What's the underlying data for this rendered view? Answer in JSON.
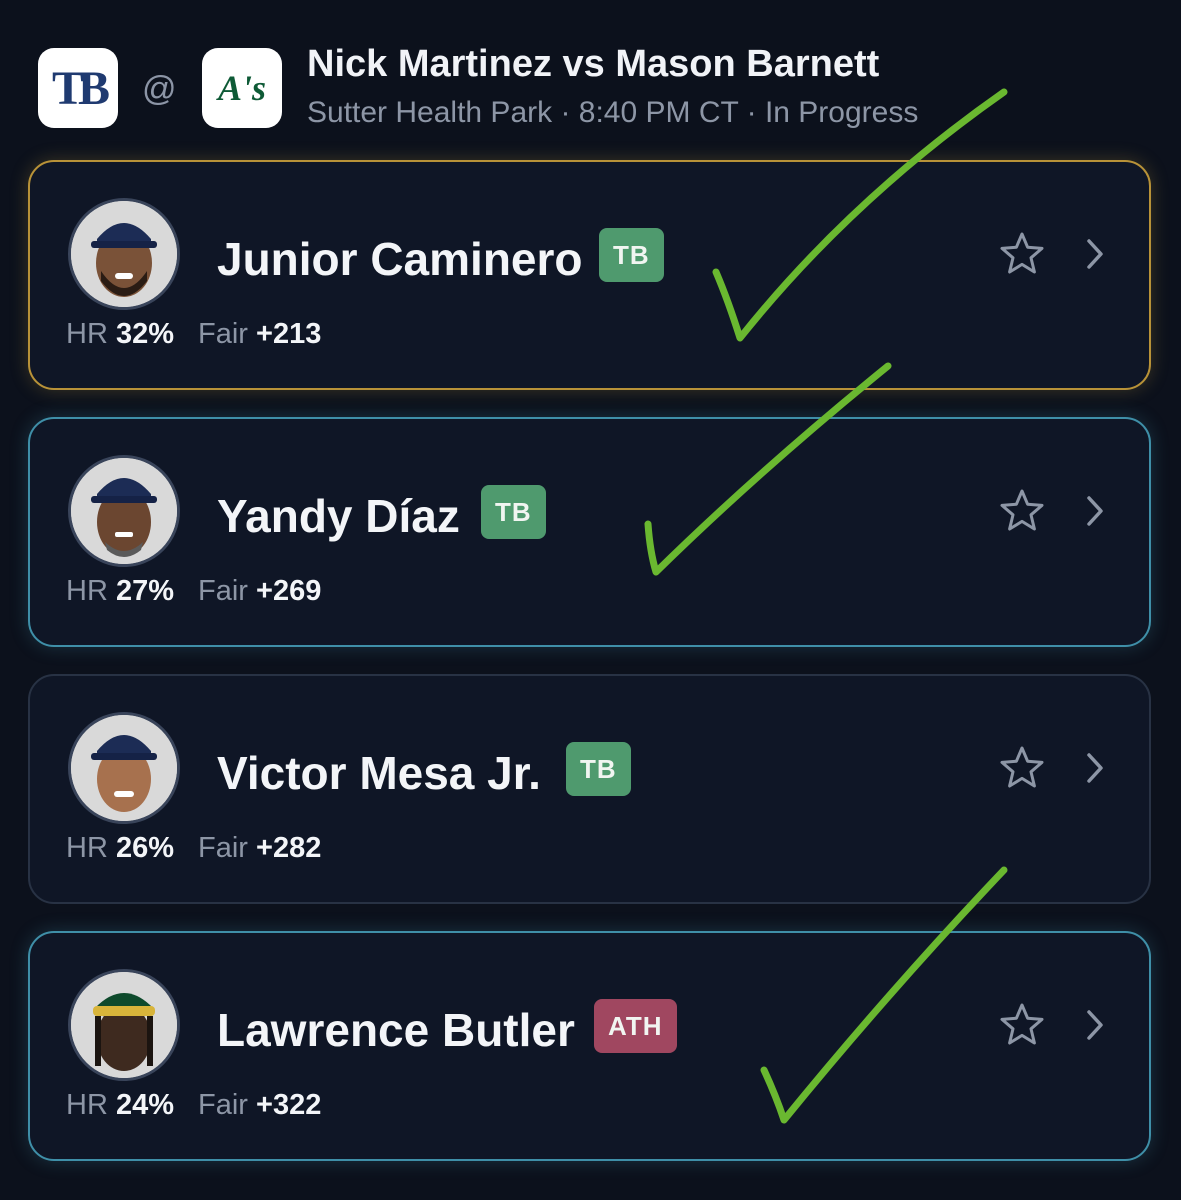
{
  "header": {
    "away_logo": "TB",
    "home_logo": "A's",
    "separator": "@",
    "matchup": "Nick Martinez vs Mason Barnett",
    "subtitle": "Sutter Health Park · 8:40 PM CT · In Progress"
  },
  "players": [
    {
      "name": "Junior Caminero",
      "team": "TB",
      "hr_label": "HR",
      "hr_value": "32%",
      "fair_label": "Fair",
      "fair_value": "+213"
    },
    {
      "name": "Yandy Díaz",
      "team": "TB",
      "hr_label": "HR",
      "hr_value": "27%",
      "fair_label": "Fair",
      "fair_value": "+269"
    },
    {
      "name": "Victor Mesa Jr.",
      "team": "TB",
      "hr_label": "HR",
      "hr_value": "26%",
      "fair_label": "Fair",
      "fair_value": "+282"
    },
    {
      "name": "Lawrence Butler",
      "team": "ATH",
      "hr_label": "HR",
      "hr_value": "24%",
      "fair_label": "Fair",
      "fair_value": "+322"
    }
  ],
  "colors": {
    "background": "#0c111c",
    "card": "#0f1626",
    "gold_border": "#b89238",
    "cyan_border": "#3f8fa8",
    "tb_badge": "#4f9a6e",
    "ath_badge": "#a04760",
    "checkmark": "#6ab830"
  },
  "icons": [
    "star-icon",
    "chevron-right-icon",
    "checkmark-annotation"
  ]
}
